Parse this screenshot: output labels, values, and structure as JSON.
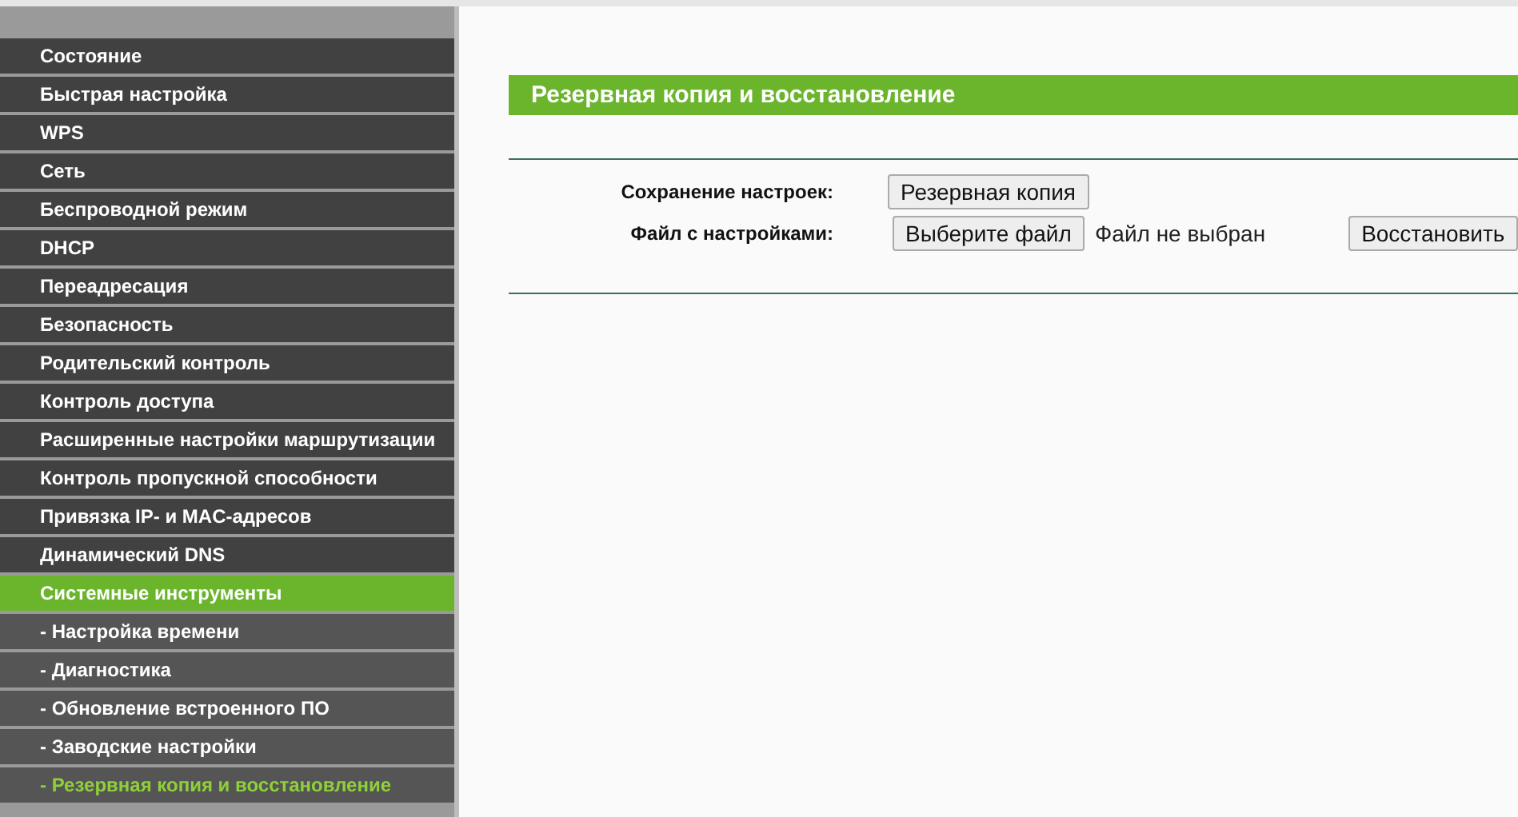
{
  "sidebar": {
    "items": [
      {
        "label": "Состояние",
        "kind": "main",
        "selected": false
      },
      {
        "label": "Быстрая настройка",
        "kind": "main",
        "selected": false
      },
      {
        "label": "WPS",
        "kind": "main",
        "selected": false
      },
      {
        "label": "Сеть",
        "kind": "main",
        "selected": false
      },
      {
        "label": "Беспроводной режим",
        "kind": "main",
        "selected": false
      },
      {
        "label": "DHCP",
        "kind": "main",
        "selected": false
      },
      {
        "label": "Переадресация",
        "kind": "main",
        "selected": false
      },
      {
        "label": "Безопасность",
        "kind": "main",
        "selected": false
      },
      {
        "label": "Родительский контроль",
        "kind": "main",
        "selected": false
      },
      {
        "label": "Контроль доступа",
        "kind": "main",
        "selected": false
      },
      {
        "label": "Расширенные настройки маршрутизации",
        "kind": "main",
        "selected": false
      },
      {
        "label": "Контроль пропускной способности",
        "kind": "main",
        "selected": false
      },
      {
        "label": "Привязка IP- и MAC-адресов",
        "kind": "main",
        "selected": false
      },
      {
        "label": "Динамический DNS",
        "kind": "main",
        "selected": false
      },
      {
        "label": "Системные инструменты",
        "kind": "main",
        "selected": true
      },
      {
        "label": "- Настройка времени",
        "kind": "sub",
        "selected": false
      },
      {
        "label": "- Диагностика",
        "kind": "sub",
        "selected": false
      },
      {
        "label": "- Обновление встроенного ПО",
        "kind": "sub",
        "selected": false
      },
      {
        "label": "- Заводские настройки",
        "kind": "sub",
        "selected": false
      },
      {
        "label": "- Резервная копия и восстановление",
        "kind": "sub",
        "selected": true
      }
    ]
  },
  "panel": {
    "title": "Резервная копия и восстановление",
    "backup": {
      "label": "Сохранение настроек:",
      "button": "Резервная копия"
    },
    "restore": {
      "label": "Файл с настройками:",
      "choose_button": "Выберите файл",
      "file_status": "Файл не выбран",
      "button": "Восстановить"
    }
  }
}
